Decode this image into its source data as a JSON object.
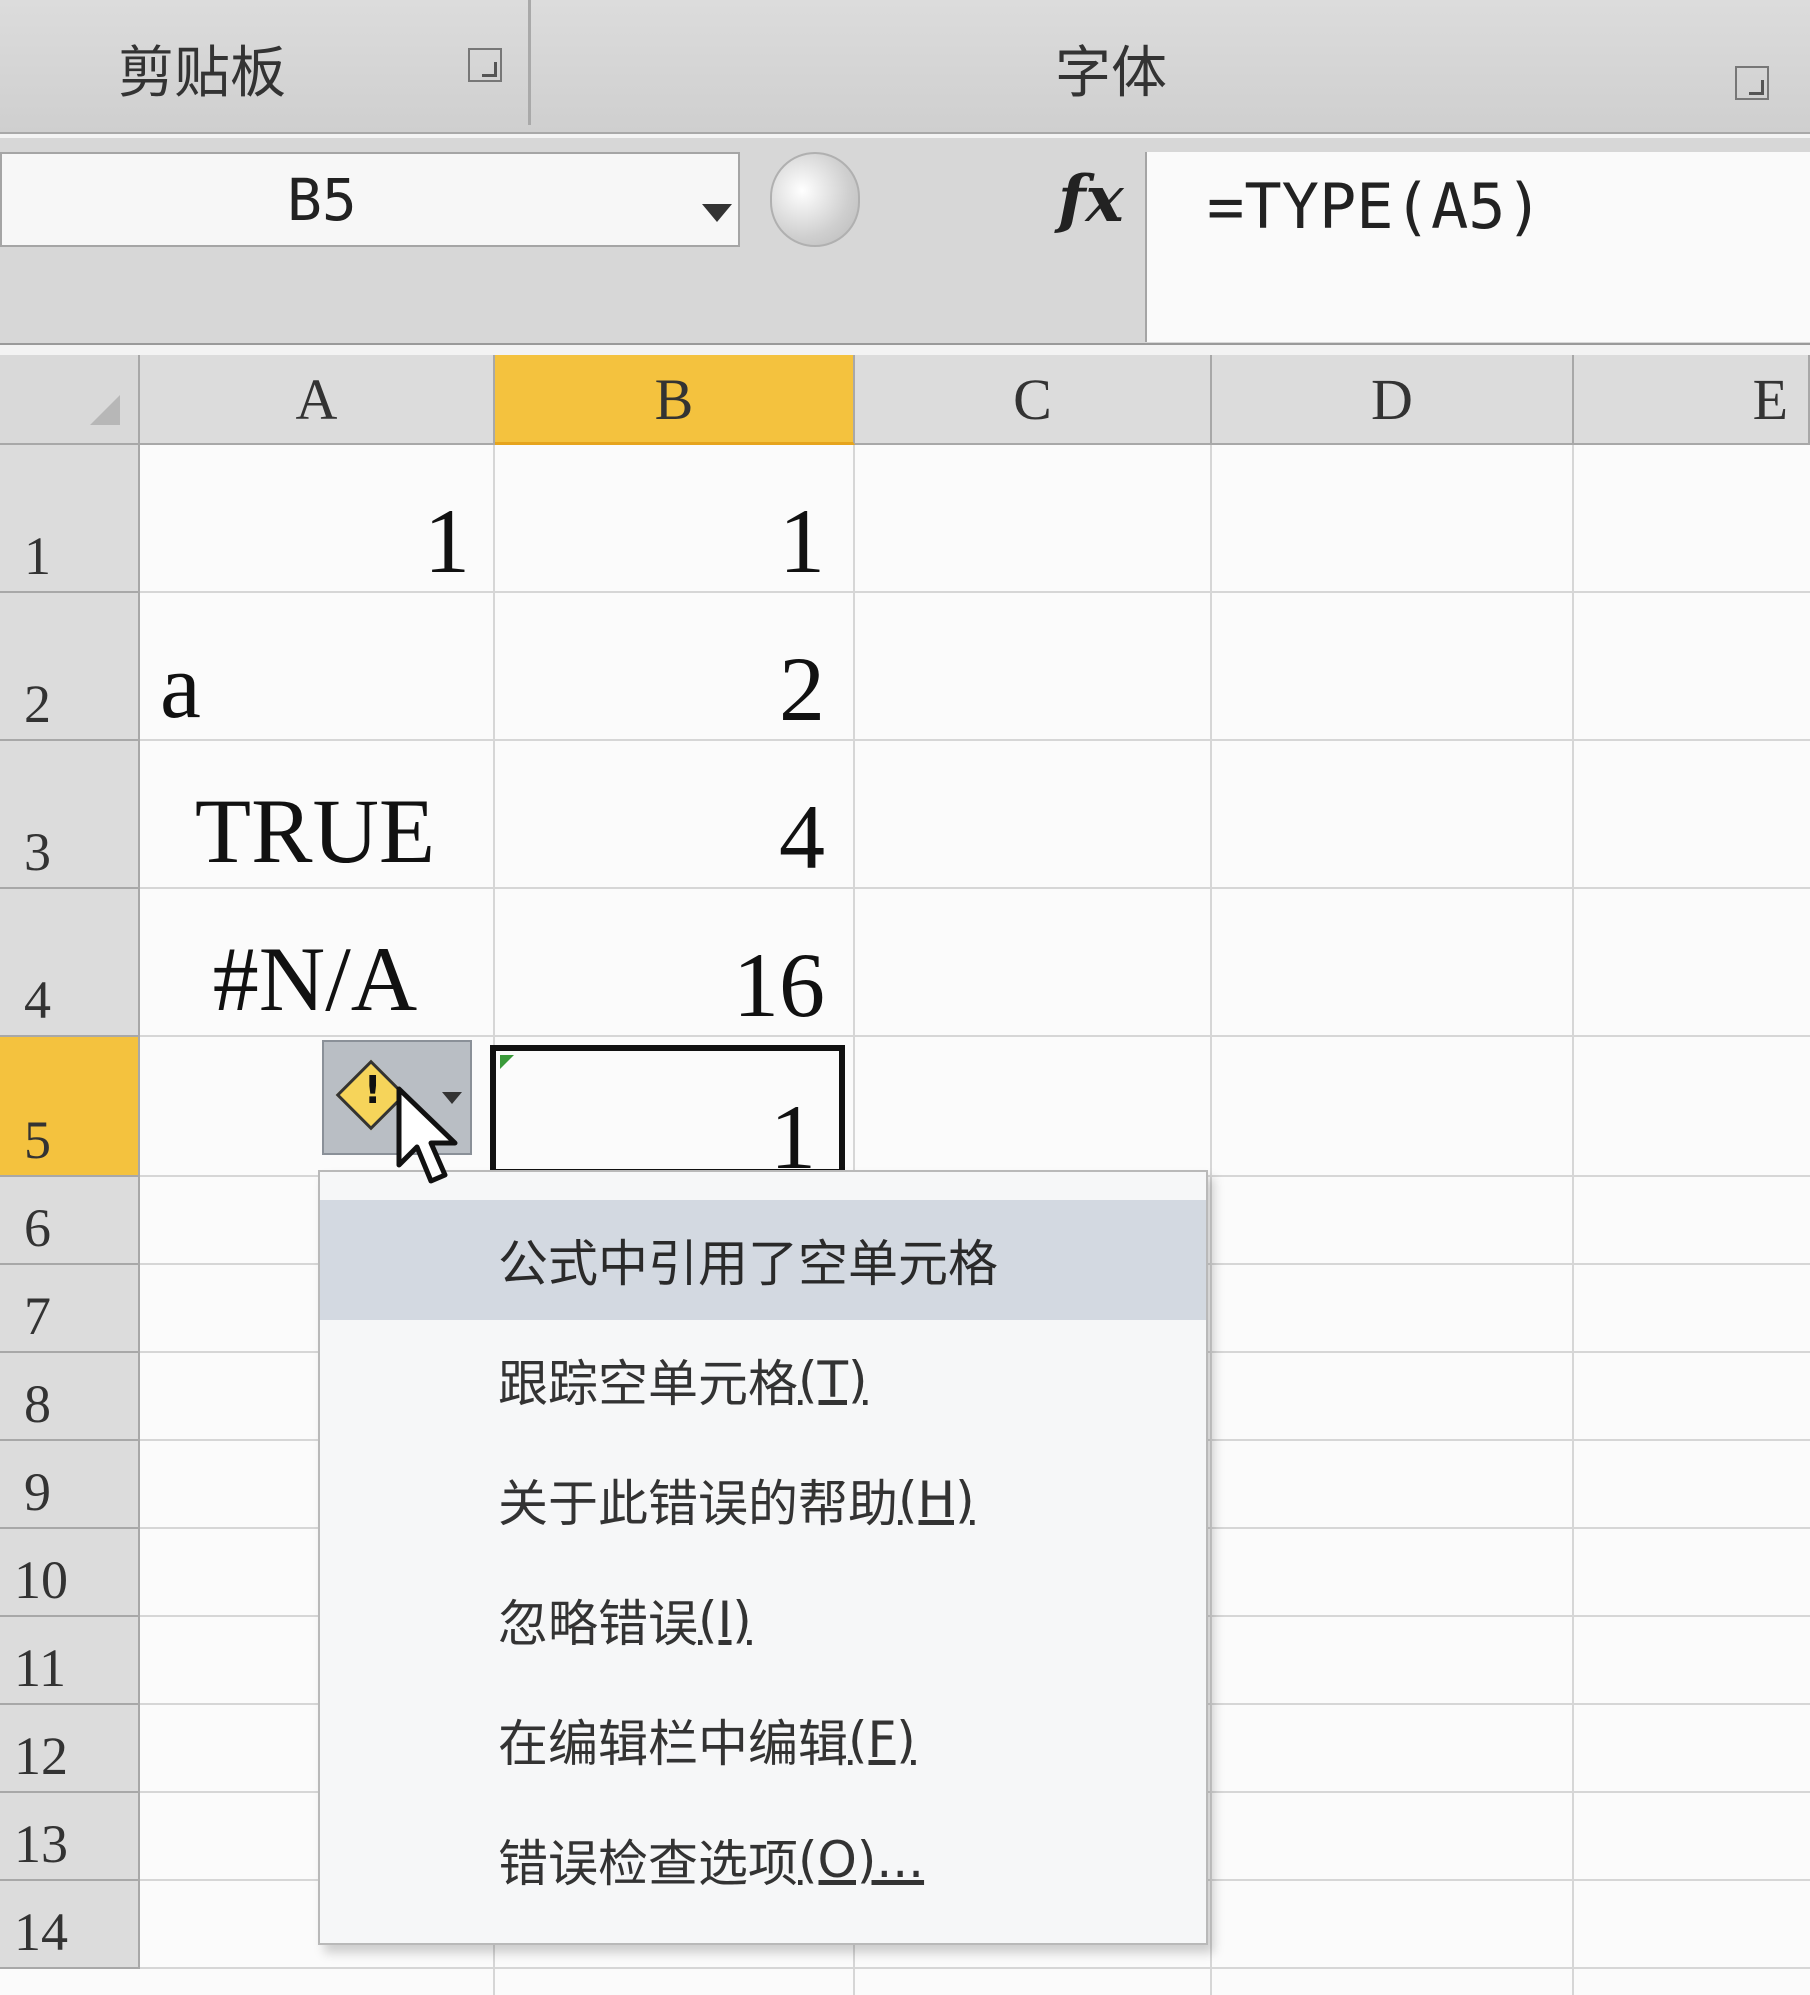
{
  "ribbon": {
    "group_clipboard": "剪贴板",
    "group_font": "字体"
  },
  "formula_bar": {
    "name_box": "B5",
    "fx_label": "fx",
    "formula": "=TYPE(A5)"
  },
  "columns": [
    "A",
    "B",
    "C",
    "D",
    "E"
  ],
  "rows": [
    "1",
    "2",
    "3",
    "4",
    "5",
    "6",
    "7",
    "8",
    "9",
    "10",
    "11",
    "12",
    "13",
    "14"
  ],
  "cells": {
    "A1": "1",
    "A2": "a",
    "A3": "TRUE",
    "A4": "#N/A",
    "B1": "1",
    "B2": "2",
    "B3": "4",
    "B4": "16",
    "B5": "1"
  },
  "selection": {
    "active_cell": "B5",
    "selected_column": "B",
    "selected_row": "5"
  },
  "error_menu": {
    "header": "公式中引用了空单元格",
    "items": [
      {
        "label": "跟踪空单元格",
        "key": "(T)"
      },
      {
        "label": "关于此错误的帮助",
        "key": "(H)"
      },
      {
        "label": "忽略错误",
        "key": "(I)"
      },
      {
        "label": "在编辑栏中编辑",
        "key": "(F)"
      },
      {
        "label": "错误检查选项",
        "key": "(O)..."
      }
    ]
  },
  "colors": {
    "selected_header": "#f4c23e",
    "smart_tag_icon": "#f6d45a",
    "error_indicator": "#3a9a3a"
  },
  "icons": [
    "dialog-launcher-icon",
    "name-box-dropdown-icon",
    "fx-icon",
    "error-warning-icon",
    "mouse-cursor-icon",
    "select-all-icon"
  ]
}
